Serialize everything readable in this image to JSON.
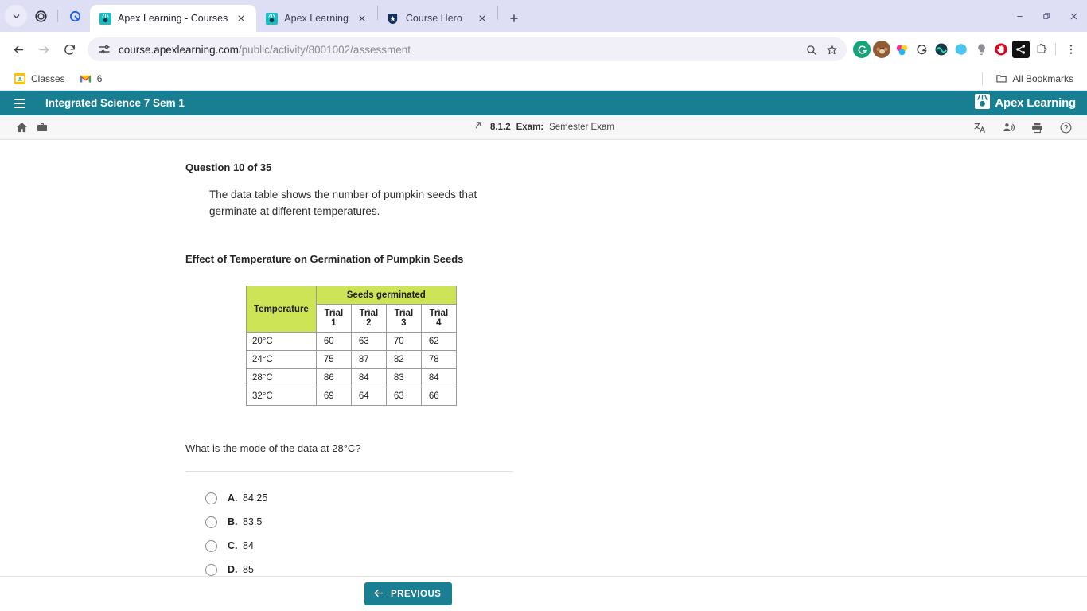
{
  "browser": {
    "tabs": [
      {
        "title": "Apex Learning - Courses",
        "favicon": "apex-favicon",
        "active": true
      },
      {
        "title": "Apex Learning",
        "favicon": "apex-favicon",
        "active": false
      },
      {
        "title": "Course Hero",
        "favicon": "coursehero-favicon",
        "active": false
      }
    ],
    "new_tab_label": "+",
    "window_controls": {
      "minimize": "minimize",
      "maximize": "maximize",
      "close": "close"
    },
    "omnibox": {
      "url_host": "course.apexlearning.com",
      "url_path": "/public/activity/8001002/assessment",
      "site_icon": "tune-site-settings-icon",
      "zoom_icon": "search-icon",
      "bookmark_icon": "star-icon"
    },
    "extensions": [
      {
        "name": "grammarly-extension",
        "color": "#15a47a",
        "glyph": "G"
      },
      {
        "name": "monkey-avatar-extension",
        "color": "#8a5a33",
        "glyph": "●"
      },
      {
        "name": "colorful-dots-extension",
        "color": "#e8308a",
        "glyph": "●"
      },
      {
        "name": "grammarly-check-extension",
        "color": "#3c3c3c",
        "glyph": "G"
      },
      {
        "name": "wave-extension",
        "color": "#1b4f6b",
        "glyph": "W"
      },
      {
        "name": "blue-swirl-extension",
        "color": "#4ab7e8",
        "glyph": "●"
      },
      {
        "name": "lightbulb-extension",
        "color": "#8a8a8a",
        "glyph": "●"
      },
      {
        "name": "adblock-extension",
        "color": "#e4001b",
        "glyph": "✋"
      },
      {
        "name": "share-nodes-extension",
        "color": "#111111",
        "glyph": "⁂"
      },
      {
        "name": "extensions-puzzle-icon",
        "color": "#5f6368",
        "glyph": "⬚"
      }
    ],
    "menu_icon": "kebab-menu-icon",
    "bookmarks": [
      {
        "label": "Classes",
        "icon": "google-classroom-icon"
      },
      {
        "label": "6",
        "icon": "gmail-icon"
      }
    ],
    "all_bookmarks_label": "All Bookmarks",
    "all_bookmarks_icon": "folder-icon"
  },
  "apex": {
    "header": {
      "menu_icon": "hamburger-menu-icon",
      "course_title": "Integrated Science 7 Sem 1",
      "brand": "Apex Learning",
      "brand_icon": "apex-logo-icon",
      "bg_color": "#177f91"
    },
    "subbar": {
      "home_icon": "home-icon",
      "briefcase_icon": "briefcase-icon",
      "up_icon": "arrow-up-right-icon",
      "crumb_number": "8.1.2",
      "crumb_type": "Exam:",
      "crumb_name": "Semester Exam",
      "right_icons": [
        "translate-icon",
        "read-aloud-icon",
        "print-icon",
        "help-icon"
      ]
    }
  },
  "question": {
    "heading": "Question 10 of 35",
    "stem": "The data table shows the number of pumpkin seeds that germinate at different temperatures.",
    "prompt": "What is the mode of the data at 28°C?",
    "choices": [
      {
        "letter": "A.",
        "text": "84.25",
        "selected": false
      },
      {
        "letter": "B.",
        "text": "83.5",
        "selected": false
      },
      {
        "letter": "C.",
        "text": "84",
        "selected": false
      },
      {
        "letter": "D.",
        "text": "85",
        "selected": false
      }
    ]
  },
  "chart_data": {
    "type": "table",
    "title": "Effect of Temperature on Germination of Pumpkin Seeds",
    "header_color": "#cde456",
    "group_header": {
      "col1": "Temperature",
      "group": "Seeds germinated"
    },
    "columns": [
      "",
      "Trial 1",
      "Trial 2",
      "Trial 3",
      "Trial 4"
    ],
    "categories": [
      "20°C",
      "24°C",
      "28°C",
      "32°C"
    ],
    "xlabel": "Temperature",
    "ylabel": "Seeds germinated",
    "series": [
      {
        "name": "Trial 1",
        "values": [
          60,
          75,
          86,
          69
        ]
      },
      {
        "name": "Trial 2",
        "values": [
          63,
          87,
          84,
          64
        ]
      },
      {
        "name": "Trial 3",
        "values": [
          70,
          82,
          83,
          63
        ]
      },
      {
        "name": "Trial 4",
        "values": [
          62,
          78,
          84,
          66
        ]
      }
    ],
    "rows": [
      {
        "label": "20°C",
        "cells": [
          "60",
          "63",
          "70",
          "62"
        ]
      },
      {
        "label": "24°C",
        "cells": [
          "75",
          "87",
          "82",
          "78"
        ]
      },
      {
        "label": "28°C",
        "cells": [
          "86",
          "84",
          "83",
          "84"
        ]
      },
      {
        "label": "32°C",
        "cells": [
          "69",
          "64",
          "63",
          "66"
        ]
      }
    ]
  },
  "footer": {
    "previous_label": "PREVIOUS",
    "previous_icon": "arrow-left-icon",
    "button_color": "#1b7f93"
  }
}
